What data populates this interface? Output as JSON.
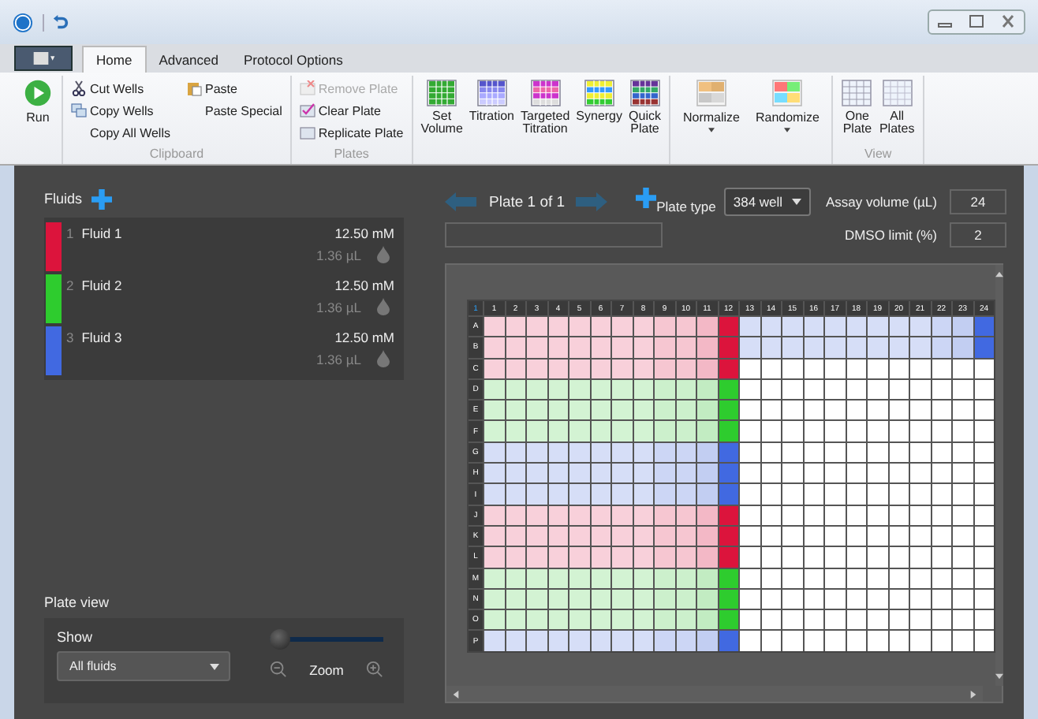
{
  "tabs": [
    {
      "label": "Home",
      "selected": true
    },
    {
      "label": "Advanced",
      "selected": false
    },
    {
      "label": "Protocol Options",
      "selected": false
    }
  ],
  "ribbon": {
    "run": {
      "label": "Run"
    },
    "clipboard": {
      "title": "Clipboard",
      "items": [
        {
          "label": "Cut Wells"
        },
        {
          "label": "Copy Wells"
        },
        {
          "label": "Copy All Wells"
        },
        {
          "label": "Paste"
        },
        {
          "label": "Paste Special"
        }
      ]
    },
    "plates": {
      "title": "Plates",
      "items": [
        {
          "label": "Remove Plate",
          "disabled": true
        },
        {
          "label": "Clear Plate",
          "disabled": false
        },
        {
          "label": "Replicate Plate",
          "disabled": false
        }
      ]
    },
    "tools": [
      {
        "label": "Set Volume"
      },
      {
        "label": "Titration"
      },
      {
        "label": "Targeted Titration"
      },
      {
        "label": "Synergy"
      },
      {
        "label": "Quick Plate"
      }
    ],
    "arrange": [
      {
        "label": "Normalize",
        "dropdown": true
      },
      {
        "label": "Randomize",
        "dropdown": true
      }
    ],
    "view": {
      "title": "View",
      "items": [
        {
          "label": "One Plate"
        },
        {
          "label": "All Plates"
        }
      ]
    }
  },
  "fluids": {
    "title": "Fluids",
    "items": [
      {
        "number": "1",
        "name": "Fluid 1",
        "concentration": "12.50 mM",
        "volume": "1.36 µL",
        "color": "#dc143c"
      },
      {
        "number": "2",
        "name": "Fluid 2",
        "concentration": "12.50 mM",
        "volume": "1.36 µL",
        "color": "#2ecc2e"
      },
      {
        "number": "3",
        "name": "Fluid 3",
        "concentration": "12.50 mM",
        "volume": "1.36 µL",
        "color": "#4169e1"
      }
    ]
  },
  "plate_nav": {
    "label": "Plate 1 of 1"
  },
  "plate_type": {
    "label": "Plate type",
    "value": "384 well"
  },
  "assay_volume": {
    "label": "Assay volume (µL)",
    "value": "24"
  },
  "dmso_limit": {
    "label": "DMSO limit (%)",
    "value": "2"
  },
  "plate": {
    "corner": "1",
    "columns": [
      "1",
      "2",
      "3",
      "4",
      "5",
      "6",
      "7",
      "8",
      "9",
      "10",
      "11",
      "12",
      "13",
      "14",
      "15",
      "16",
      "17",
      "18",
      "19",
      "20",
      "21",
      "22",
      "23",
      "24"
    ],
    "rows": [
      {
        "label": "A",
        "wells": [
          {
            "color": "#f8d0da"
          },
          {
            "color": "#f8d0da"
          },
          {
            "color": "#f8d0da"
          },
          {
            "color": "#f8d0da"
          },
          {
            "color": "#f8d0da"
          },
          {
            "color": "#f8d0da"
          },
          {
            "color": "#f8d0da"
          },
          {
            "color": "#f8d0da"
          },
          {
            "color": "#f6c6d1"
          },
          {
            "color": "#f6c6d1"
          },
          {
            "color": "#f3b8c6"
          },
          {
            "color": "#dc143c"
          },
          {
            "color": "#d6def7"
          },
          {
            "color": "#d6def7"
          },
          {
            "color": "#d6def7"
          },
          {
            "color": "#d6def7"
          },
          {
            "color": "#d6def7"
          },
          {
            "color": "#d6def7"
          },
          {
            "color": "#d6def7"
          },
          {
            "color": "#d6def7"
          },
          {
            "color": "#d6def7"
          },
          {
            "color": "#ccd6f5"
          },
          {
            "color": "#c2cef2"
          },
          {
            "color": "#4169e1"
          }
        ]
      },
      {
        "label": "B",
        "wells": [
          {
            "color": "#f8d0da"
          },
          {
            "color": "#f8d0da"
          },
          {
            "color": "#f8d0da"
          },
          {
            "color": "#f8d0da"
          },
          {
            "color": "#f8d0da"
          },
          {
            "color": "#f8d0da"
          },
          {
            "color": "#f8d0da"
          },
          {
            "color": "#f8d0da"
          },
          {
            "color": "#f6c6d1"
          },
          {
            "color": "#f6c6d1"
          },
          {
            "color": "#f3b8c6"
          },
          {
            "color": "#dc143c"
          },
          {
            "color": "#d6def7"
          },
          {
            "color": "#d6def7"
          },
          {
            "color": "#d6def7"
          },
          {
            "color": "#d6def7"
          },
          {
            "color": "#d6def7"
          },
          {
            "color": "#d6def7"
          },
          {
            "color": "#d6def7"
          },
          {
            "color": "#d6def7"
          },
          {
            "color": "#d6def7"
          },
          {
            "color": "#ccd6f5"
          },
          {
            "color": "#c2cef2"
          },
          {
            "color": "#4169e1"
          }
        ]
      },
      {
        "label": "C",
        "wells": [
          {
            "color": "#f8d0da"
          },
          {
            "color": "#f8d0da"
          },
          {
            "color": "#f8d0da"
          },
          {
            "color": "#f8d0da"
          },
          {
            "color": "#f8d0da"
          },
          {
            "color": "#f8d0da"
          },
          {
            "color": "#f8d0da"
          },
          {
            "color": "#f8d0da"
          },
          {
            "color": "#f6c6d1"
          },
          {
            "color": "#f6c6d1"
          },
          {
            "color": "#f3b8c6"
          },
          {
            "color": "#dc143c"
          },
          {
            "color": "#ffffff"
          },
          {
            "color": "#ffffff"
          },
          {
            "color": "#ffffff"
          },
          {
            "color": "#ffffff"
          },
          {
            "color": "#ffffff"
          },
          {
            "color": "#ffffff"
          },
          {
            "color": "#ffffff"
          },
          {
            "color": "#ffffff"
          },
          {
            "color": "#ffffff"
          },
          {
            "color": "#ffffff"
          },
          {
            "color": "#ffffff"
          },
          {
            "color": "#ffffff"
          }
        ]
      },
      {
        "label": "D",
        "wells": [
          {
            "color": "#d3f3d3"
          },
          {
            "color": "#d3f3d3"
          },
          {
            "color": "#d3f3d3"
          },
          {
            "color": "#d3f3d3"
          },
          {
            "color": "#d3f3d3"
          },
          {
            "color": "#d3f3d3"
          },
          {
            "color": "#d3f3d3"
          },
          {
            "color": "#d3f3d3"
          },
          {
            "color": "#ccf0cc"
          },
          {
            "color": "#ccf0cc"
          },
          {
            "color": "#c2ecc2"
          },
          {
            "color": "#2ecc2e"
          },
          {
            "color": "#ffffff"
          },
          {
            "color": "#ffffff"
          },
          {
            "color": "#ffffff"
          },
          {
            "color": "#ffffff"
          },
          {
            "color": "#ffffff"
          },
          {
            "color": "#ffffff"
          },
          {
            "color": "#ffffff"
          },
          {
            "color": "#ffffff"
          },
          {
            "color": "#ffffff"
          },
          {
            "color": "#ffffff"
          },
          {
            "color": "#ffffff"
          },
          {
            "color": "#ffffff"
          }
        ]
      },
      {
        "label": "E",
        "wells": [
          {
            "color": "#d3f3d3"
          },
          {
            "color": "#d3f3d3"
          },
          {
            "color": "#d3f3d3"
          },
          {
            "color": "#d3f3d3"
          },
          {
            "color": "#d3f3d3"
          },
          {
            "color": "#d3f3d3"
          },
          {
            "color": "#d3f3d3"
          },
          {
            "color": "#d3f3d3"
          },
          {
            "color": "#ccf0cc"
          },
          {
            "color": "#ccf0cc"
          },
          {
            "color": "#c2ecc2"
          },
          {
            "color": "#2ecc2e"
          },
          {
            "color": "#ffffff"
          },
          {
            "color": "#ffffff"
          },
          {
            "color": "#ffffff"
          },
          {
            "color": "#ffffff"
          },
          {
            "color": "#ffffff"
          },
          {
            "color": "#ffffff"
          },
          {
            "color": "#ffffff"
          },
          {
            "color": "#ffffff"
          },
          {
            "color": "#ffffff"
          },
          {
            "color": "#ffffff"
          },
          {
            "color": "#ffffff"
          },
          {
            "color": "#ffffff"
          }
        ]
      },
      {
        "label": "F",
        "wells": [
          {
            "color": "#d3f3d3"
          },
          {
            "color": "#d3f3d3"
          },
          {
            "color": "#d3f3d3"
          },
          {
            "color": "#d3f3d3"
          },
          {
            "color": "#d3f3d3"
          },
          {
            "color": "#d3f3d3"
          },
          {
            "color": "#d3f3d3"
          },
          {
            "color": "#d3f3d3"
          },
          {
            "color": "#ccf0cc"
          },
          {
            "color": "#ccf0cc"
          },
          {
            "color": "#c2ecc2"
          },
          {
            "color": "#2ecc2e"
          },
          {
            "color": "#ffffff"
          },
          {
            "color": "#ffffff"
          },
          {
            "color": "#ffffff"
          },
          {
            "color": "#ffffff"
          },
          {
            "color": "#ffffff"
          },
          {
            "color": "#ffffff"
          },
          {
            "color": "#ffffff"
          },
          {
            "color": "#ffffff"
          },
          {
            "color": "#ffffff"
          },
          {
            "color": "#ffffff"
          },
          {
            "color": "#ffffff"
          },
          {
            "color": "#ffffff"
          }
        ]
      },
      {
        "label": "G",
        "wells": [
          {
            "color": "#d6def7"
          },
          {
            "color": "#d6def7"
          },
          {
            "color": "#d6def7"
          },
          {
            "color": "#d6def7"
          },
          {
            "color": "#d6def7"
          },
          {
            "color": "#d6def7"
          },
          {
            "color": "#d6def7"
          },
          {
            "color": "#d6def7"
          },
          {
            "color": "#ccd6f5"
          },
          {
            "color": "#ccd6f5"
          },
          {
            "color": "#c2cef2"
          },
          {
            "color": "#4169e1"
          },
          {
            "color": "#ffffff"
          },
          {
            "color": "#ffffff"
          },
          {
            "color": "#ffffff"
          },
          {
            "color": "#ffffff"
          },
          {
            "color": "#ffffff"
          },
          {
            "color": "#ffffff"
          },
          {
            "color": "#ffffff"
          },
          {
            "color": "#ffffff"
          },
          {
            "color": "#ffffff"
          },
          {
            "color": "#ffffff"
          },
          {
            "color": "#ffffff"
          },
          {
            "color": "#ffffff"
          }
        ]
      },
      {
        "label": "H",
        "wells": [
          {
            "color": "#d6def7"
          },
          {
            "color": "#d6def7"
          },
          {
            "color": "#d6def7"
          },
          {
            "color": "#d6def7"
          },
          {
            "color": "#d6def7"
          },
          {
            "color": "#d6def7"
          },
          {
            "color": "#d6def7"
          },
          {
            "color": "#d6def7"
          },
          {
            "color": "#ccd6f5"
          },
          {
            "color": "#ccd6f5"
          },
          {
            "color": "#c2cef2"
          },
          {
            "color": "#4169e1"
          },
          {
            "color": "#ffffff"
          },
          {
            "color": "#ffffff"
          },
          {
            "color": "#ffffff"
          },
          {
            "color": "#ffffff"
          },
          {
            "color": "#ffffff"
          },
          {
            "color": "#ffffff"
          },
          {
            "color": "#ffffff"
          },
          {
            "color": "#ffffff"
          },
          {
            "color": "#ffffff"
          },
          {
            "color": "#ffffff"
          },
          {
            "color": "#ffffff"
          },
          {
            "color": "#ffffff"
          }
        ]
      },
      {
        "label": "I",
        "wells": [
          {
            "color": "#d6def7"
          },
          {
            "color": "#d6def7"
          },
          {
            "color": "#d6def7"
          },
          {
            "color": "#d6def7"
          },
          {
            "color": "#d6def7"
          },
          {
            "color": "#d6def7"
          },
          {
            "color": "#d6def7"
          },
          {
            "color": "#d6def7"
          },
          {
            "color": "#ccd6f5"
          },
          {
            "color": "#ccd6f5"
          },
          {
            "color": "#c2cef2"
          },
          {
            "color": "#4169e1"
          },
          {
            "color": "#ffffff"
          },
          {
            "color": "#ffffff"
          },
          {
            "color": "#ffffff"
          },
          {
            "color": "#ffffff"
          },
          {
            "color": "#ffffff"
          },
          {
            "color": "#ffffff"
          },
          {
            "color": "#ffffff"
          },
          {
            "color": "#ffffff"
          },
          {
            "color": "#ffffff"
          },
          {
            "color": "#ffffff"
          },
          {
            "color": "#ffffff"
          },
          {
            "color": "#ffffff"
          }
        ]
      },
      {
        "label": "J",
        "wells": [
          {
            "color": "#f8d0da"
          },
          {
            "color": "#f8d0da"
          },
          {
            "color": "#f8d0da"
          },
          {
            "color": "#f8d0da"
          },
          {
            "color": "#f8d0da"
          },
          {
            "color": "#f8d0da"
          },
          {
            "color": "#f8d0da"
          },
          {
            "color": "#f8d0da"
          },
          {
            "color": "#f6c6d1"
          },
          {
            "color": "#f6c6d1"
          },
          {
            "color": "#f3b8c6"
          },
          {
            "color": "#dc143c"
          },
          {
            "color": "#ffffff"
          },
          {
            "color": "#ffffff"
          },
          {
            "color": "#ffffff"
          },
          {
            "color": "#ffffff"
          },
          {
            "color": "#ffffff"
          },
          {
            "color": "#ffffff"
          },
          {
            "color": "#ffffff"
          },
          {
            "color": "#ffffff"
          },
          {
            "color": "#ffffff"
          },
          {
            "color": "#ffffff"
          },
          {
            "color": "#ffffff"
          },
          {
            "color": "#ffffff"
          }
        ]
      },
      {
        "label": "K",
        "wells": [
          {
            "color": "#f8d0da"
          },
          {
            "color": "#f8d0da"
          },
          {
            "color": "#f8d0da"
          },
          {
            "color": "#f8d0da"
          },
          {
            "color": "#f8d0da"
          },
          {
            "color": "#f8d0da"
          },
          {
            "color": "#f8d0da"
          },
          {
            "color": "#f8d0da"
          },
          {
            "color": "#f6c6d1"
          },
          {
            "color": "#f6c6d1"
          },
          {
            "color": "#f3b8c6"
          },
          {
            "color": "#dc143c"
          },
          {
            "color": "#ffffff"
          },
          {
            "color": "#ffffff"
          },
          {
            "color": "#ffffff"
          },
          {
            "color": "#ffffff"
          },
          {
            "color": "#ffffff"
          },
          {
            "color": "#ffffff"
          },
          {
            "color": "#ffffff"
          },
          {
            "color": "#ffffff"
          },
          {
            "color": "#ffffff"
          },
          {
            "color": "#ffffff"
          },
          {
            "color": "#ffffff"
          },
          {
            "color": "#ffffff"
          }
        ]
      },
      {
        "label": "L",
        "wells": [
          {
            "color": "#f8d0da"
          },
          {
            "color": "#f8d0da"
          },
          {
            "color": "#f8d0da"
          },
          {
            "color": "#f8d0da"
          },
          {
            "color": "#f8d0da"
          },
          {
            "color": "#f8d0da"
          },
          {
            "color": "#f8d0da"
          },
          {
            "color": "#f8d0da"
          },
          {
            "color": "#f6c6d1"
          },
          {
            "color": "#f6c6d1"
          },
          {
            "color": "#f3b8c6"
          },
          {
            "color": "#dc143c"
          },
          {
            "color": "#ffffff"
          },
          {
            "color": "#ffffff"
          },
          {
            "color": "#ffffff"
          },
          {
            "color": "#ffffff"
          },
          {
            "color": "#ffffff"
          },
          {
            "color": "#ffffff"
          },
          {
            "color": "#ffffff"
          },
          {
            "color": "#ffffff"
          },
          {
            "color": "#ffffff"
          },
          {
            "color": "#ffffff"
          },
          {
            "color": "#ffffff"
          },
          {
            "color": "#ffffff"
          }
        ]
      },
      {
        "label": "M",
        "wells": [
          {
            "color": "#d3f3d3"
          },
          {
            "color": "#d3f3d3"
          },
          {
            "color": "#d3f3d3"
          },
          {
            "color": "#d3f3d3"
          },
          {
            "color": "#d3f3d3"
          },
          {
            "color": "#d3f3d3"
          },
          {
            "color": "#d3f3d3"
          },
          {
            "color": "#d3f3d3"
          },
          {
            "color": "#ccf0cc"
          },
          {
            "color": "#ccf0cc"
          },
          {
            "color": "#c2ecc2"
          },
          {
            "color": "#2ecc2e"
          },
          {
            "color": "#ffffff"
          },
          {
            "color": "#ffffff"
          },
          {
            "color": "#ffffff"
          },
          {
            "color": "#ffffff"
          },
          {
            "color": "#ffffff"
          },
          {
            "color": "#ffffff"
          },
          {
            "color": "#ffffff"
          },
          {
            "color": "#ffffff"
          },
          {
            "color": "#ffffff"
          },
          {
            "color": "#ffffff"
          },
          {
            "color": "#ffffff"
          },
          {
            "color": "#ffffff"
          }
        ]
      },
      {
        "label": "N",
        "wells": [
          {
            "color": "#d3f3d3"
          },
          {
            "color": "#d3f3d3"
          },
          {
            "color": "#d3f3d3"
          },
          {
            "color": "#d3f3d3"
          },
          {
            "color": "#d3f3d3"
          },
          {
            "color": "#d3f3d3"
          },
          {
            "color": "#d3f3d3"
          },
          {
            "color": "#d3f3d3"
          },
          {
            "color": "#ccf0cc"
          },
          {
            "color": "#ccf0cc"
          },
          {
            "color": "#c2ecc2"
          },
          {
            "color": "#2ecc2e"
          },
          {
            "color": "#ffffff"
          },
          {
            "color": "#ffffff"
          },
          {
            "color": "#ffffff"
          },
          {
            "color": "#ffffff"
          },
          {
            "color": "#ffffff"
          },
          {
            "color": "#ffffff"
          },
          {
            "color": "#ffffff"
          },
          {
            "color": "#ffffff"
          },
          {
            "color": "#ffffff"
          },
          {
            "color": "#ffffff"
          },
          {
            "color": "#ffffff"
          },
          {
            "color": "#ffffff"
          }
        ]
      },
      {
        "label": "O",
        "wells": [
          {
            "color": "#d3f3d3"
          },
          {
            "color": "#d3f3d3"
          },
          {
            "color": "#d3f3d3"
          },
          {
            "color": "#d3f3d3"
          },
          {
            "color": "#d3f3d3"
          },
          {
            "color": "#d3f3d3"
          },
          {
            "color": "#d3f3d3"
          },
          {
            "color": "#d3f3d3"
          },
          {
            "color": "#ccf0cc"
          },
          {
            "color": "#ccf0cc"
          },
          {
            "color": "#c2ecc2"
          },
          {
            "color": "#2ecc2e"
          },
          {
            "color": "#ffffff"
          },
          {
            "color": "#ffffff"
          },
          {
            "color": "#ffffff"
          },
          {
            "color": "#ffffff"
          },
          {
            "color": "#ffffff"
          },
          {
            "color": "#ffffff"
          },
          {
            "color": "#ffffff"
          },
          {
            "color": "#ffffff"
          },
          {
            "color": "#ffffff"
          },
          {
            "color": "#ffffff"
          },
          {
            "color": "#ffffff"
          },
          {
            "color": "#ffffff"
          }
        ]
      },
      {
        "label": "P",
        "wells": [
          {
            "color": "#d6def7"
          },
          {
            "color": "#d6def7"
          },
          {
            "color": "#d6def7"
          },
          {
            "color": "#d6def7"
          },
          {
            "color": "#d6def7"
          },
          {
            "color": "#d6def7"
          },
          {
            "color": "#d6def7"
          },
          {
            "color": "#d6def7"
          },
          {
            "color": "#ccd6f5"
          },
          {
            "color": "#ccd6f5"
          },
          {
            "color": "#c2cef2"
          },
          {
            "color": "#4169e1"
          },
          {
            "color": "#ffffff"
          },
          {
            "color": "#ffffff"
          },
          {
            "color": "#ffffff"
          },
          {
            "color": "#ffffff"
          },
          {
            "color": "#ffffff"
          },
          {
            "color": "#ffffff"
          },
          {
            "color": "#ffffff"
          },
          {
            "color": "#ffffff"
          },
          {
            "color": "#ffffff"
          },
          {
            "color": "#ffffff"
          },
          {
            "color": "#ffffff"
          },
          {
            "color": "#ffffff"
          }
        ]
      }
    ]
  },
  "plate_view": {
    "title": "Plate view",
    "show_label": "Show",
    "show_value": "All fluids",
    "zoom_label": "Zoom",
    "level": 0.1
  }
}
